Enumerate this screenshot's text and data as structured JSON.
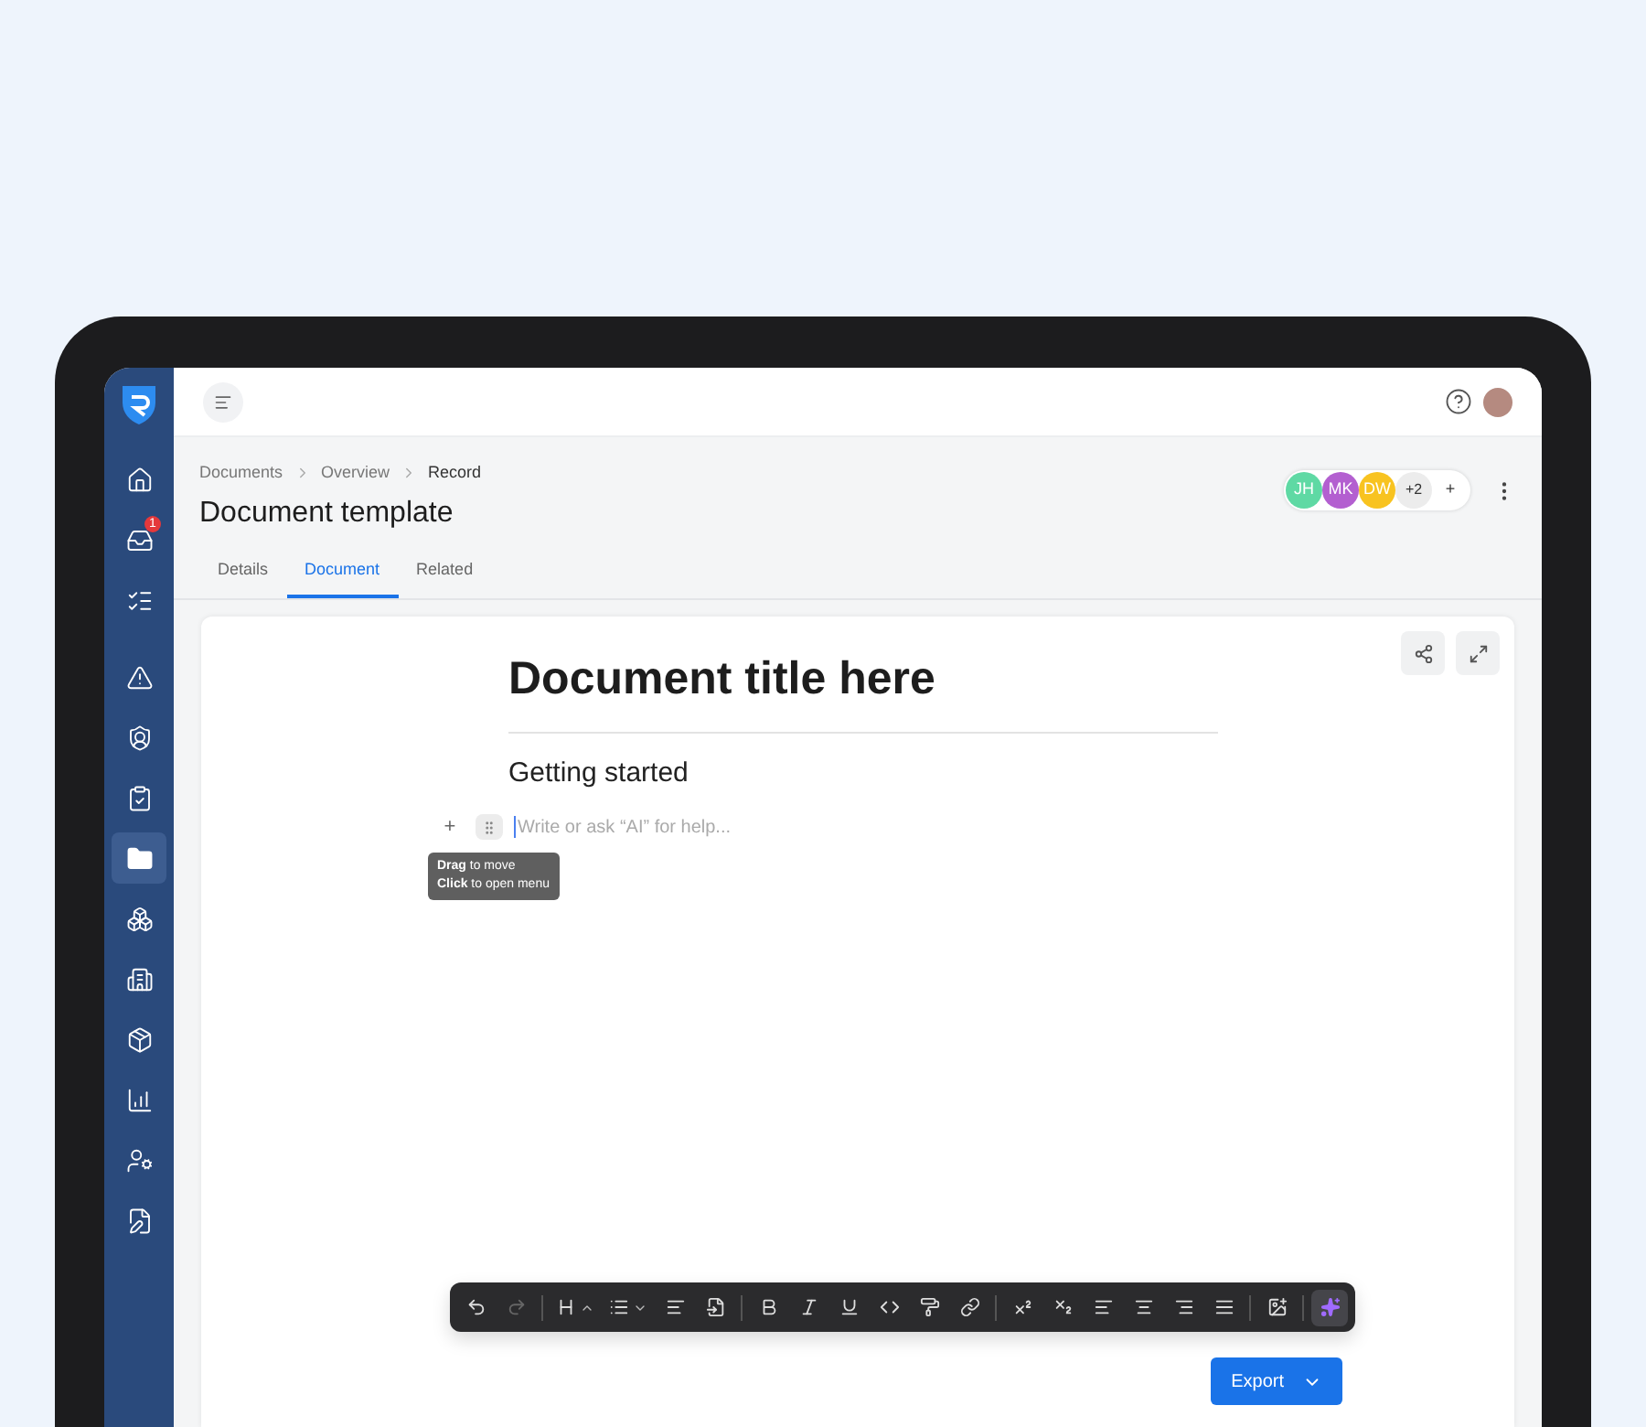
{
  "sidebar": {
    "items": [
      {
        "kind": "home",
        "selected": false
      },
      {
        "kind": "inbox",
        "selected": false,
        "badge": "1"
      },
      {
        "kind": "list",
        "selected": false
      },
      {
        "kind": "alert",
        "selected": false
      },
      {
        "kind": "shield",
        "selected": false
      },
      {
        "kind": "clipboard",
        "selected": false
      },
      {
        "kind": "folder",
        "selected": true
      },
      {
        "kind": "boxes",
        "selected": false
      },
      {
        "kind": "building",
        "selected": false
      },
      {
        "kind": "package",
        "selected": false
      },
      {
        "kind": "chart",
        "selected": false
      },
      {
        "kind": "user",
        "selected": false
      },
      {
        "kind": "form",
        "selected": false
      }
    ]
  },
  "breadcrumbs": [
    "Documents",
    "Overview",
    "Record"
  ],
  "title": "Document template",
  "collaborators": [
    {
      "initials": "JH",
      "color": "#5fd9a4"
    },
    {
      "initials": "MK",
      "color": "#b35fd0"
    },
    {
      "initials": "DW",
      "color": "#f8c320"
    }
  ],
  "more_collaborators": "+2",
  "add_collaborator": "+",
  "tabs": [
    {
      "label": "Details",
      "selected": false
    },
    {
      "label": "Document",
      "selected": true
    },
    {
      "label": "Related",
      "selected": false
    }
  ],
  "editor": {
    "doc_title": "Document title here",
    "heading": "Getting started",
    "placeholder": "Write or ask “AI” for help...",
    "plus": "+",
    "tooltip": [
      "**Drag** to move",
      "**Click** to open menu"
    ]
  },
  "toolbar": [
    {
      "kind": "undo",
      "disabled": false,
      "selected": false
    },
    {
      "kind": "redo",
      "disabled": true,
      "selected": false
    },
    {
      "kind": "sep"
    },
    {
      "kind": "heading",
      "disabled": false,
      "selected": false
    },
    {
      "kind": "list",
      "disabled": false,
      "selected": false
    },
    {
      "kind": "block",
      "disabled": false,
      "selected": false
    },
    {
      "kind": "embed",
      "disabled": false,
      "selected": false
    },
    {
      "kind": "sep"
    },
    {
      "kind": "bold",
      "disabled": false,
      "selected": false
    },
    {
      "kind": "italic",
      "disabled": false,
      "selected": false
    },
    {
      "kind": "underline",
      "disabled": false,
      "selected": false
    },
    {
      "kind": "code",
      "disabled": false,
      "selected": false
    },
    {
      "kind": "paint",
      "disabled": false,
      "selected": false
    },
    {
      "kind": "link",
      "disabled": false,
      "selected": false
    },
    {
      "kind": "sep"
    },
    {
      "kind": "superscript",
      "disabled": false,
      "selected": false
    },
    {
      "kind": "subscript",
      "disabled": false,
      "selected": false
    },
    {
      "kind": "align-left",
      "disabled": false,
      "selected": false
    },
    {
      "kind": "align-center",
      "disabled": false,
      "selected": false
    },
    {
      "kind": "align-right",
      "disabled": false,
      "selected": false
    },
    {
      "kind": "justify",
      "disabled": false,
      "selected": false
    },
    {
      "kind": "sep"
    },
    {
      "kind": "image",
      "disabled": false,
      "selected": false
    },
    {
      "kind": "sep"
    },
    {
      "kind": "ai",
      "disabled": false,
      "selected": true
    }
  ],
  "export_button": "Export"
}
